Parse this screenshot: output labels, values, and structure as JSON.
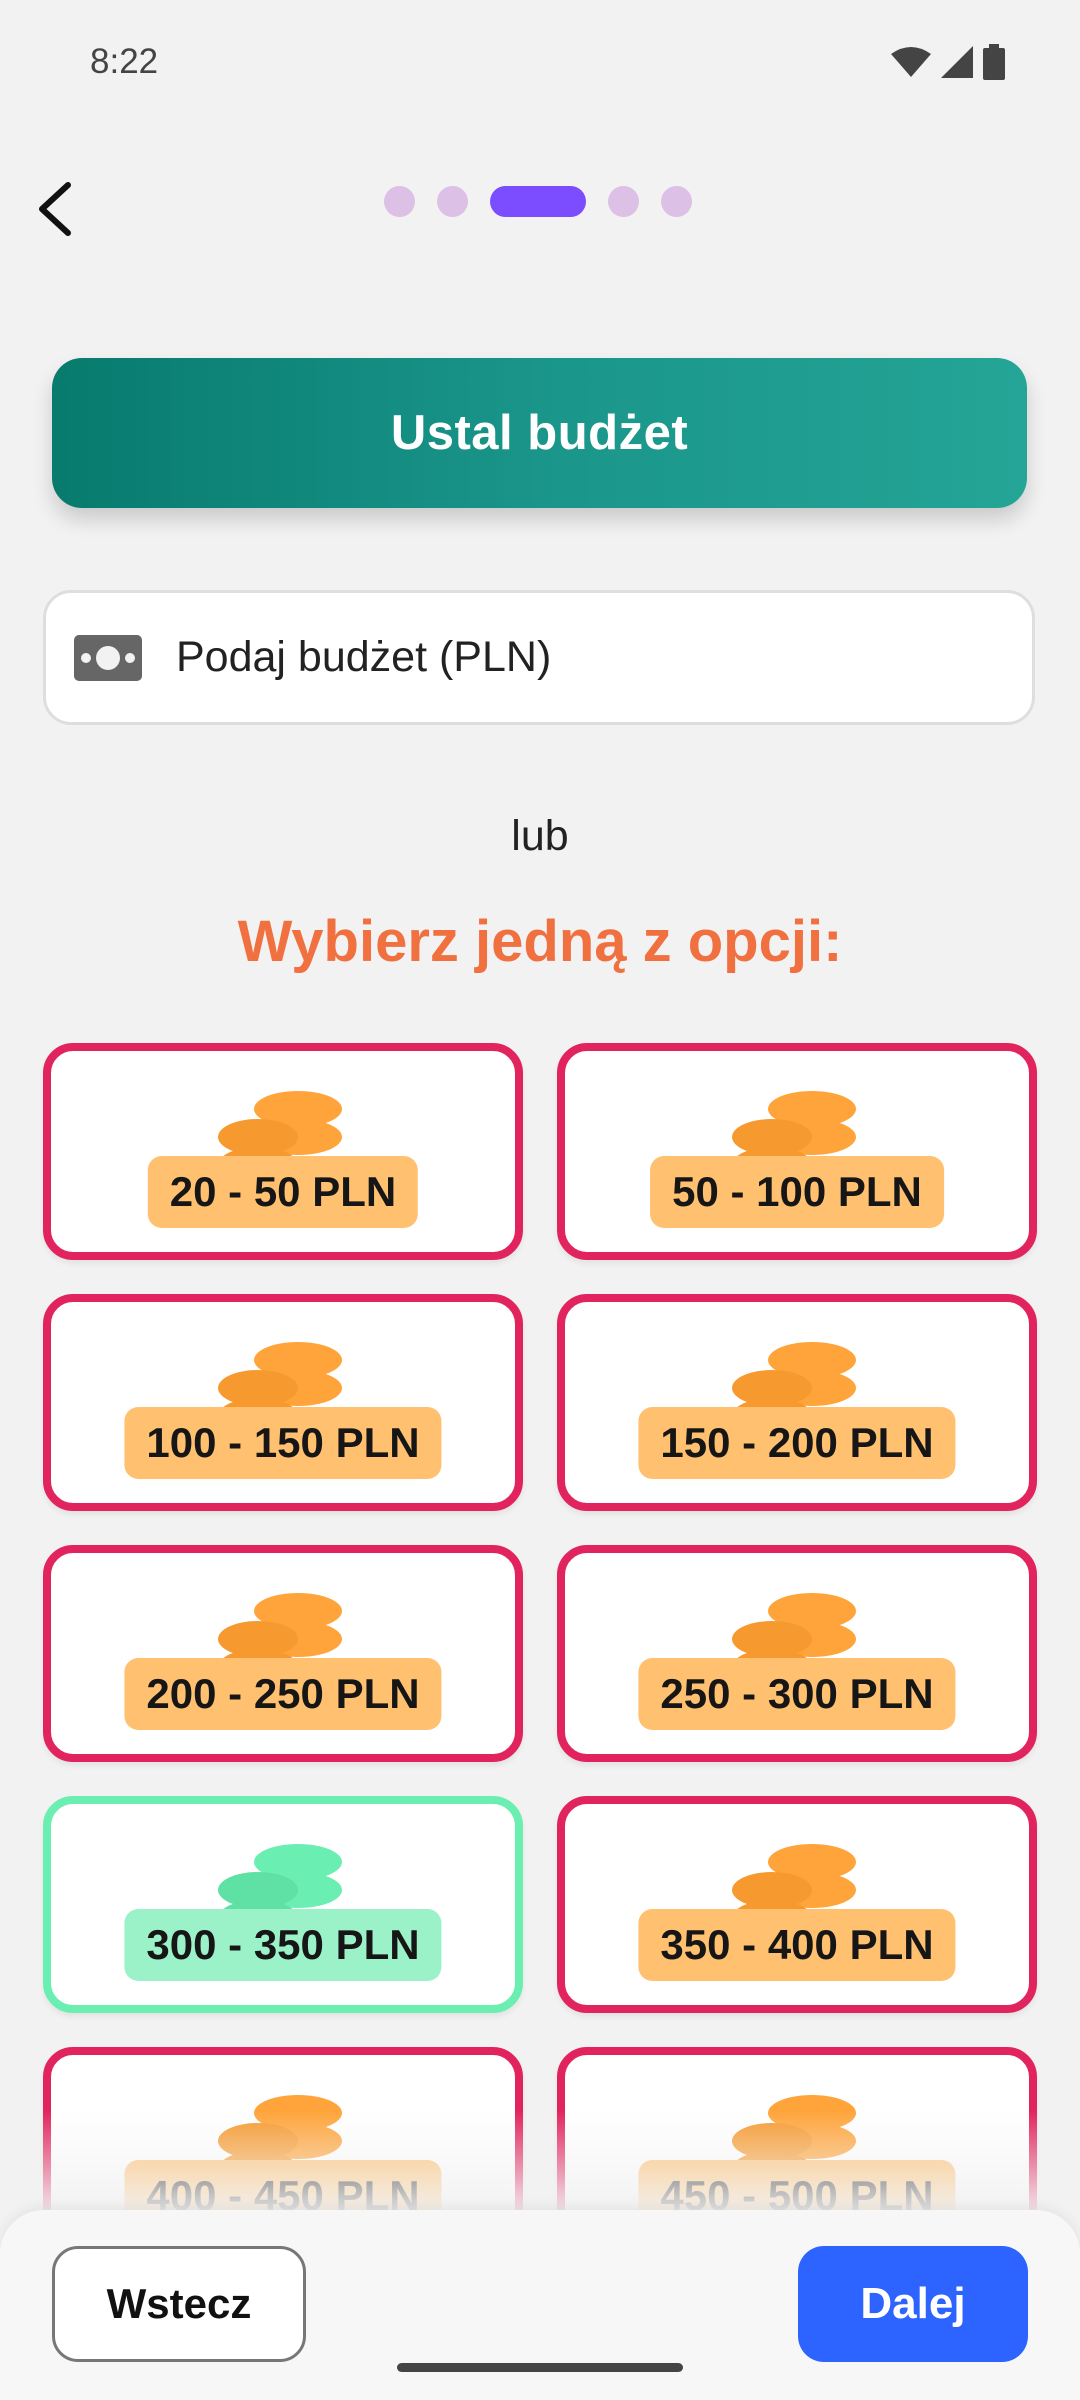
{
  "status": {
    "time": "8:22"
  },
  "progress": {
    "steps": 5,
    "current": 3
  },
  "header": {
    "title": "Ustal budżet"
  },
  "budget_input": {
    "placeholder": "Podaj budżet (PLN)",
    "value": ""
  },
  "labels": {
    "or": "lub",
    "choose": "Wybierz jedną z opcji:"
  },
  "options": [
    {
      "label": "20 - 50 PLN",
      "selected": false
    },
    {
      "label": "50 - 100 PLN",
      "selected": false
    },
    {
      "label": "100 - 150 PLN",
      "selected": false
    },
    {
      "label": "150 - 200 PLN",
      "selected": false
    },
    {
      "label": "200 - 250 PLN",
      "selected": false
    },
    {
      "label": "250 - 300 PLN",
      "selected": false
    },
    {
      "label": "300 - 350 PLN",
      "selected": true
    },
    {
      "label": "350 - 400 PLN",
      "selected": false
    },
    {
      "label": "400 - 450 PLN",
      "selected": false
    },
    {
      "label": "450 - 500 PLN",
      "selected": false
    }
  ],
  "footer": {
    "back_label": "Wstecz",
    "next_label": "Dalej"
  },
  "colors": {
    "accent": "#7b4dff",
    "option_border": "#e2245e",
    "selected_border": "#6beeb1",
    "next": "#2d63ff"
  },
  "icons": {
    "back": "arrow-left-icon",
    "money": "banknote-icon",
    "coins": "coins-icon"
  }
}
